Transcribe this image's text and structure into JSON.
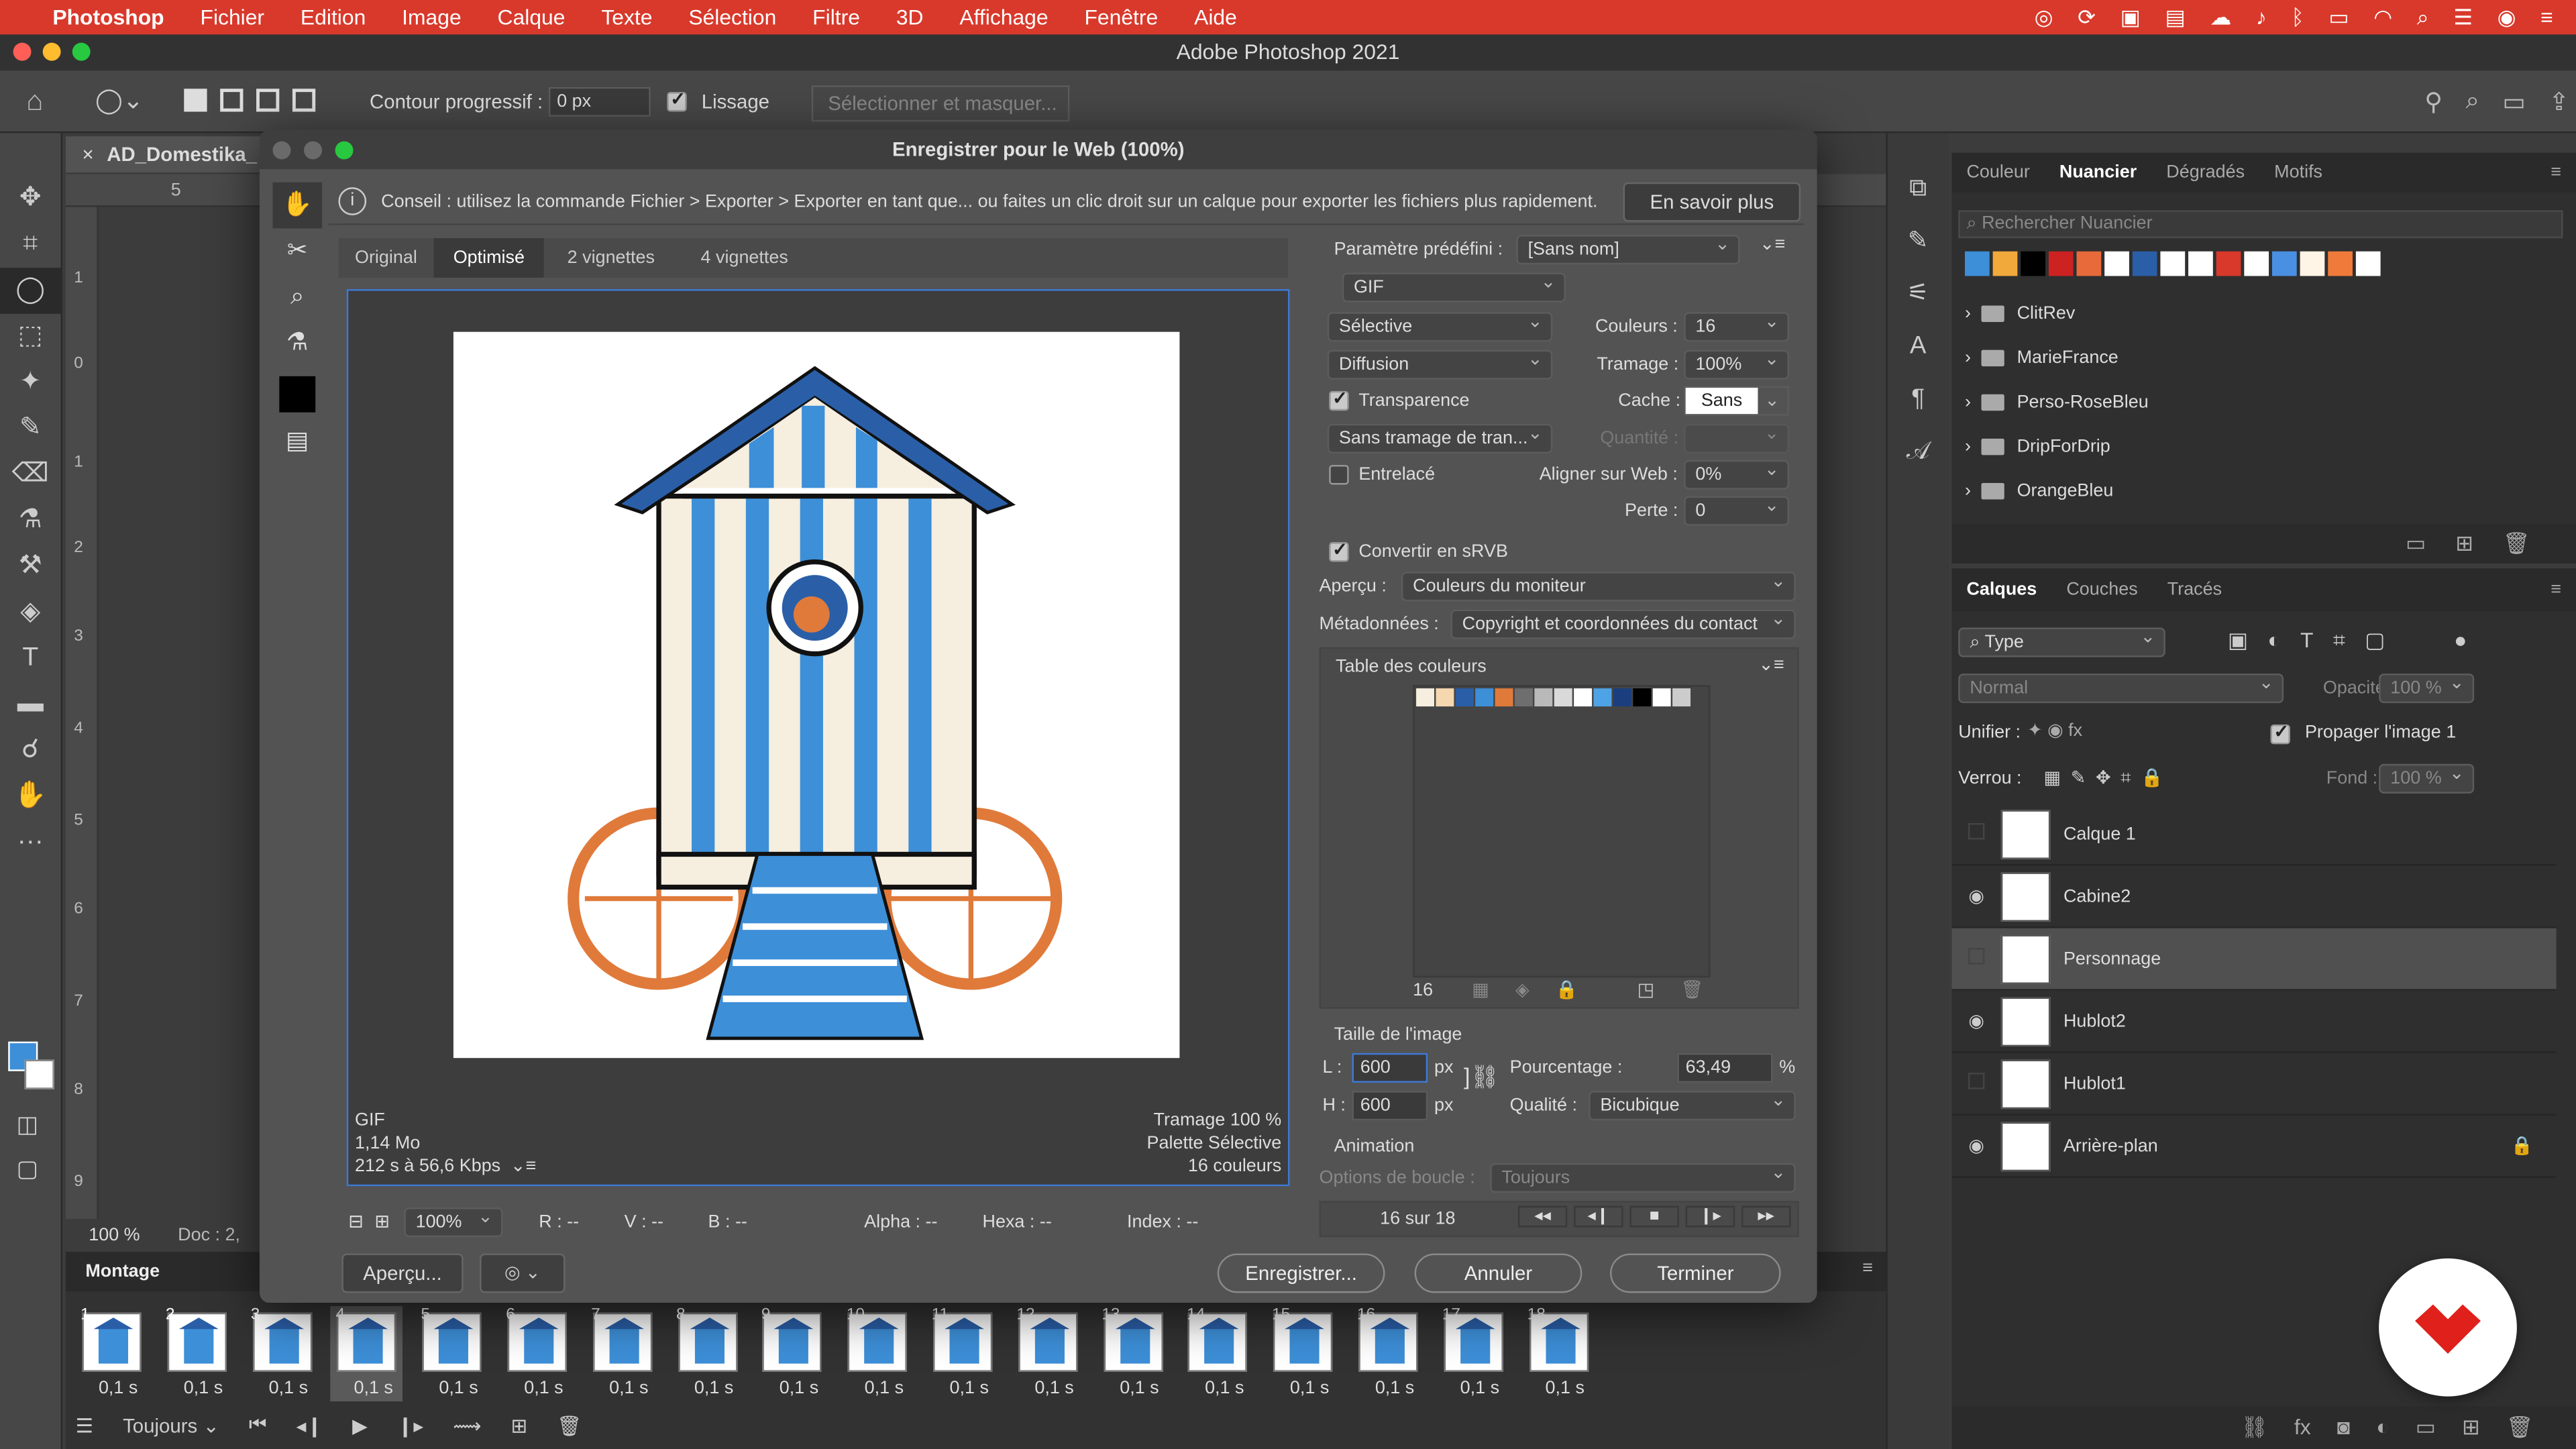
{
  "menubar": {
    "app": "Photoshop",
    "items": [
      "Fichier",
      "Edition",
      "Image",
      "Calque",
      "Texte",
      "Sélection",
      "Filtre",
      "3D",
      "Affichage",
      "Fenêtre",
      "Aide"
    ]
  },
  "window": {
    "title": "Adobe Photoshop 2021"
  },
  "options": {
    "feather_label": "Contour progressif :",
    "feather_value": "0 px",
    "smooth_label": "Lissage",
    "select_mask": "Sélectionner et masquer..."
  },
  "document": {
    "tab": "AD_Domestika_",
    "zoom": "100 %",
    "doc": "Doc : 2,",
    "ruler": [
      "1",
      "0",
      "1",
      "2",
      "3",
      "4",
      "5",
      "6",
      "7",
      "8",
      "9"
    ],
    "ruler_h": "5"
  },
  "dialog": {
    "title": "Enregistrer pour le Web (100%)",
    "tip": "Conseil : utilisez la commande Fichier > Exporter > Exporter en tant que... ou faites un clic droit sur un calque pour exporter les fichiers plus rapidement.",
    "learn_more": "En savoir plus",
    "tabs": [
      "Original",
      "Optimisé",
      "2 vignettes",
      "4 vignettes"
    ],
    "info_left": [
      "GIF",
      "1,14 Mo",
      "212 s à 56,6 Kbps"
    ],
    "info_right": [
      "Tramage 100 %",
      "Palette Sélective",
      "16 couleurs"
    ],
    "zoom": "100%",
    "readout": {
      "r": "R : --",
      "v": "V : --",
      "b": "B : --",
      "alpha": "Alpha : --",
      "hexa": "Hexa : --",
      "index": "Index : --"
    },
    "preset_label": "Paramètre prédéfini :",
    "preset": "[Sans nom]",
    "format": "GIF",
    "reduction": "Sélective",
    "dither_algo": "Diffusion",
    "colors_label": "Couleurs :",
    "colors": "16",
    "dither_label": "Tramage :",
    "dither": "100%",
    "transparency": "Transparence",
    "matte_label": "Cache :",
    "matte": "Sans",
    "trans_dither": "Sans tramage de tran...",
    "amount_label": "Quantité :",
    "interlaced": "Entrelacé",
    "websnap_label": "Aligner sur Web :",
    "websnap": "0%",
    "lossy_label": "Perte :",
    "lossy": "0",
    "srgb": "Convertir en sRVB",
    "preview_label": "Aperçu :",
    "preview": "Couleurs du moniteur",
    "meta_label": "Métadonnées :",
    "meta": "Copyright et coordonnées du contact",
    "color_table": "Table des couleurs",
    "color_count": "16",
    "palette": [
      "#f6eedf",
      "#f5d7b0",
      "#2a5fa8",
      "#3d8fd8",
      "#e07a3a",
      "#6e6e6e",
      "#b9b9b9",
      "#d9d9d9",
      "#ffffff",
      "#4ea3e6",
      "#1b3f7e",
      "#000000",
      "#ffffff",
      "#cccccc"
    ],
    "image_size": "Taille de l'image",
    "w_label": "L :",
    "w": "600",
    "h_label": "H :",
    "h": "600",
    "px": "px",
    "pct_label": "Pourcentage :",
    "pct": "63,49",
    "pct_unit": "%",
    "quality_label": "Qualité :",
    "quality": "Bicubique",
    "animation": "Animation",
    "loop_label": "Options de boucle :",
    "loop": "Toujours",
    "frame_counter": "16 sur 18",
    "preview_btn": "Aperçu...",
    "save": "Enregistrer...",
    "cancel": "Annuler",
    "done": "Terminer"
  },
  "right": {
    "tabs": [
      "Couleur",
      "Nuancier",
      "Dégradés",
      "Motifs"
    ],
    "search": "Rechercher Nuancier",
    "swatches": [
      "#3d8fd8",
      "#f2a93b",
      "#000000",
      "#cc2222",
      "#e86a3a",
      "#ffffff",
      "#2a5fa8",
      "#ffffff",
      "#ffffff",
      "#d8392b",
      "#ffffff",
      "#4a90e2",
      "#fff5e6",
      "#f07a3a",
      "#ffffff"
    ],
    "folders": [
      "ClitRev",
      "MarieFrance",
      "Perso-RoseBleu",
      "DripForDrip",
      "OrangeBleu"
    ],
    "layer_tabs": [
      "Calques",
      "Couches",
      "Tracés"
    ],
    "filter": "Type",
    "blend": "Normal",
    "opacity_label": "Opacité :",
    "opacity": "100 %",
    "unify": "Unifier :",
    "propagate": "Propager l'image 1",
    "lock": "Verrou :",
    "fill_label": "Fond :",
    "fill": "100 %",
    "layers": [
      {
        "name": "Calque 1",
        "eye": false
      },
      {
        "name": "Cabine2",
        "eye": true
      },
      {
        "name": "Personnage",
        "eye": false
      },
      {
        "name": "Hublot2",
        "eye": true
      },
      {
        "name": "Hublot1",
        "eye": false
      },
      {
        "name": "Arrière-plan",
        "eye": true
      }
    ]
  },
  "timeline": {
    "title": "Montage",
    "loop": "Toujours",
    "frames": [
      "1",
      "2",
      "3",
      "4",
      "5",
      "6",
      "7",
      "8",
      "9",
      "10",
      "11",
      "12",
      "13",
      "14",
      "15",
      "16",
      "17",
      "18"
    ],
    "delay": "0,1 s"
  }
}
